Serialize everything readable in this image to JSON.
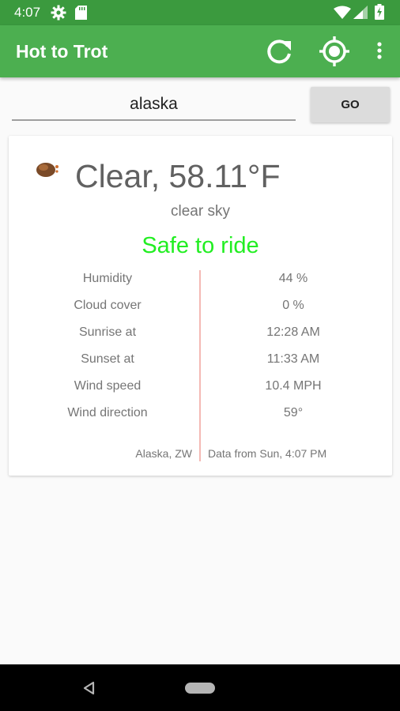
{
  "status_bar": {
    "time": "4:07"
  },
  "app_bar": {
    "title": "Hot to Trot",
    "color": "#4caf50"
  },
  "search": {
    "value": "alaska",
    "go_label": "GO"
  },
  "weather": {
    "headline": "Clear, 58.11°F",
    "description": "clear sky",
    "ride_status": "Safe to ride",
    "ride_status_color": "#22ee22",
    "details": [
      {
        "label": "Humidity",
        "value": "44 %"
      },
      {
        "label": "Cloud cover",
        "value": "0 %"
      },
      {
        "label": "Sunrise at",
        "value": "12:28 AM"
      },
      {
        "label": "Sunset at",
        "value": "11:33 AM"
      },
      {
        "label": "Wind speed",
        "value": "10.4 MPH"
      },
      {
        "label": "Wind direction",
        "value": "59°"
      }
    ],
    "location": "Alaska, ZW",
    "updated": "Data from Sun, 4:07 PM"
  },
  "icons": [
    "gear-icon",
    "sd-card-icon",
    "wifi-icon",
    "signal-icon",
    "battery-icon",
    "refresh-icon",
    "location-icon",
    "overflow-menu-icon",
    "weather-icon",
    "back-icon",
    "home-icon"
  ]
}
